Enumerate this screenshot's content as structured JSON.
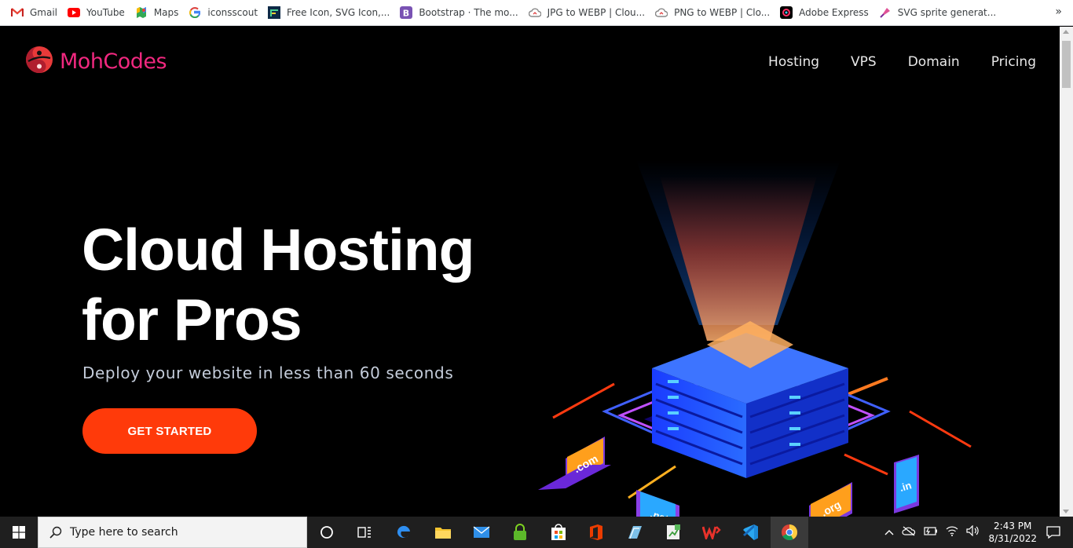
{
  "bookmarks": [
    {
      "label": "Gmail",
      "icon": "gmail-icon"
    },
    {
      "label": "YouTube",
      "icon": "youtube-icon"
    },
    {
      "label": "Maps",
      "icon": "maps-icon"
    },
    {
      "label": "iconsscout",
      "icon": "google-icon"
    },
    {
      "label": "Free Icon, SVG Icon,...",
      "icon": "flaticon-icon"
    },
    {
      "label": "Bootstrap · The mo...",
      "icon": "bootstrap-icon"
    },
    {
      "label": "JPG to WEBP | Clou...",
      "icon": "cloudconvert-icon"
    },
    {
      "label": "PNG to WEBP | Clo...",
      "icon": "cloudconvert-icon"
    },
    {
      "label": "Adobe Express",
      "icon": "adobe-express-icon"
    },
    {
      "label": "SVG sprite generat...",
      "icon": "svg-sprite-icon"
    }
  ],
  "bookmarks_more": "»",
  "site": {
    "brand": "MohCodes",
    "nav": [
      "Hosting",
      "VPS",
      "Domain",
      "Pricing"
    ],
    "hero": {
      "title_line1": "Cloud Hosting",
      "title_line2": "for Pros",
      "subtitle": "Deploy your website in less than 60 seconds",
      "cta": "GET STARTED"
    },
    "illustration_labels": {
      "com": ".com",
      "net": ".net",
      "org": ".org",
      "in": ".in"
    }
  },
  "taskbar": {
    "search_placeholder": "Type here to search",
    "time": "2:43 PM",
    "date": "8/31/2022"
  },
  "colors": {
    "brand": "#f0287f",
    "cta": "#ff3a0a",
    "background": "#000000"
  }
}
